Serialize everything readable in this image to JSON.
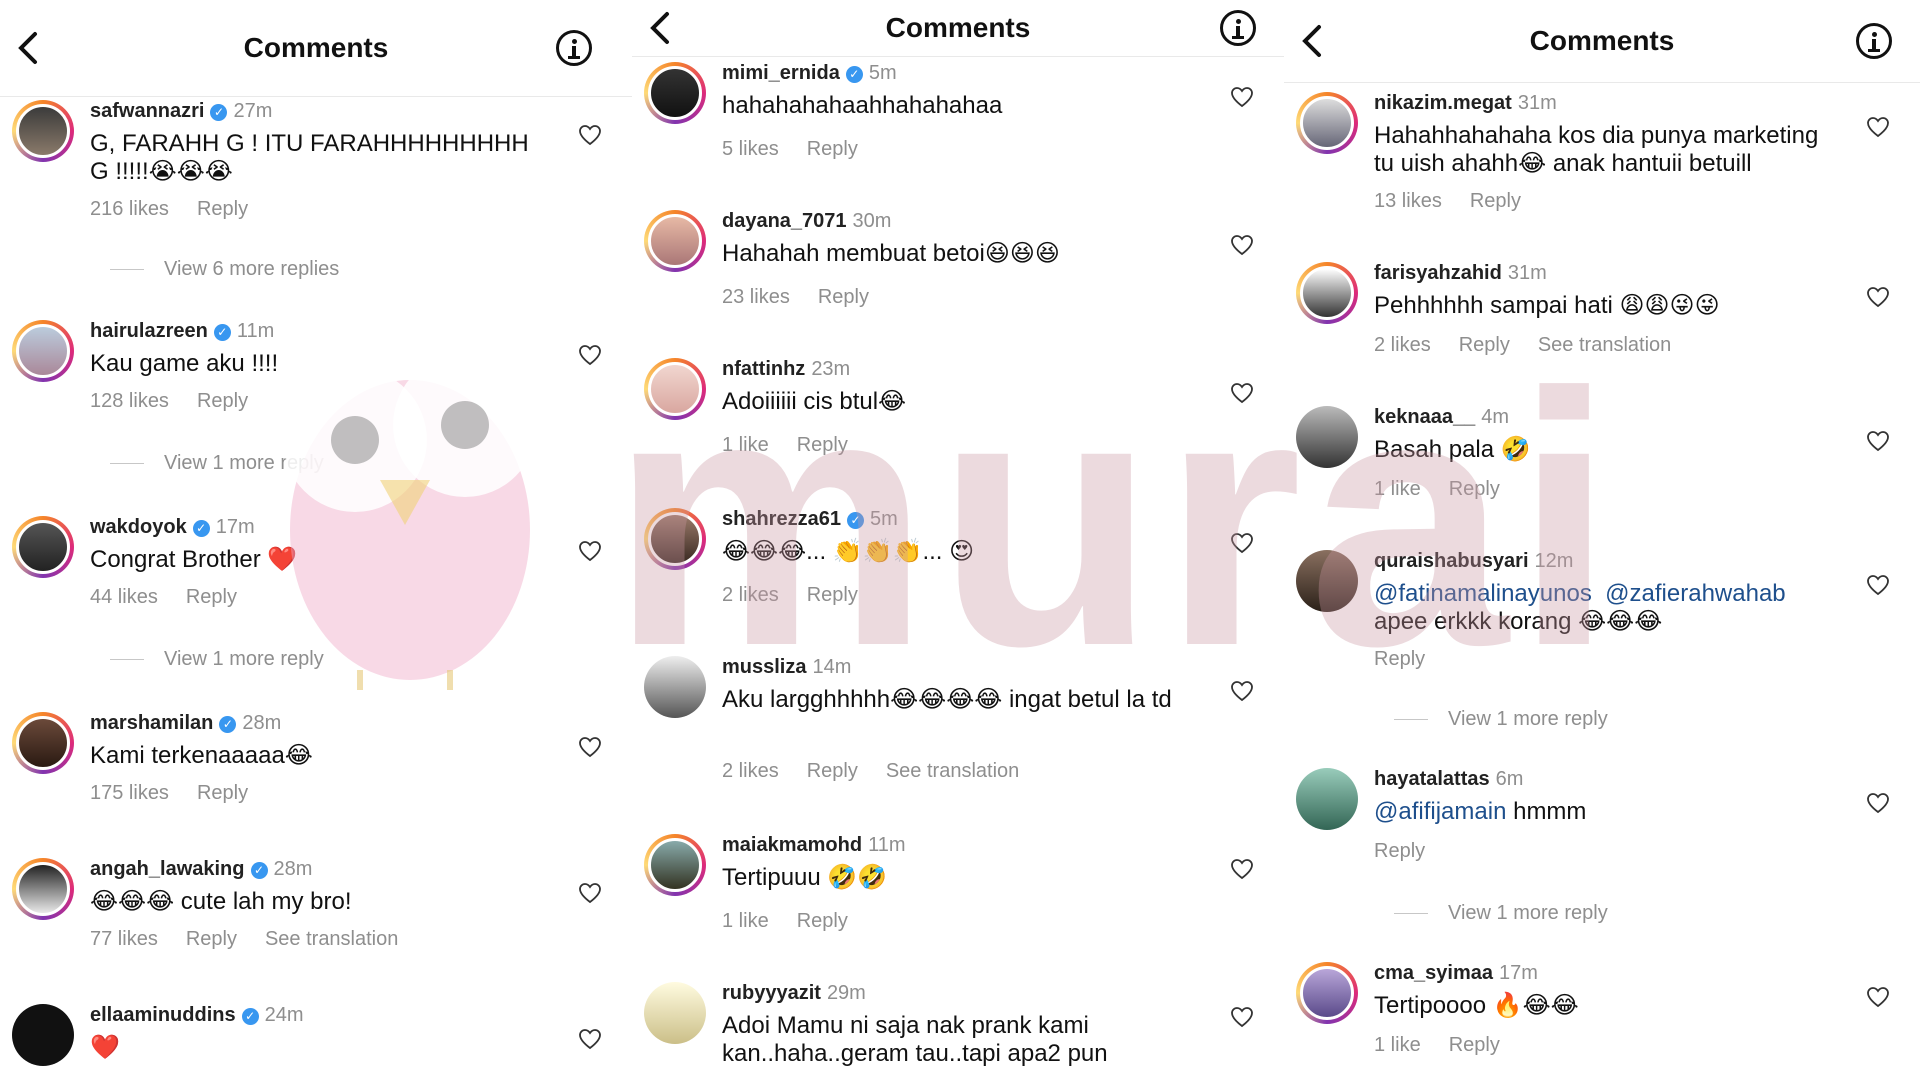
{
  "title": "Comments",
  "panel1": {
    "comments": [
      {
        "user": "safwannazri",
        "verified": true,
        "time": "27m",
        "text": "G, FARAHH G ! ITU FARAHHHHHHHHH G !!!!!😭😭😭",
        "likes": "216 likes",
        "reply": "Reply",
        "more": "View 6 more replies"
      },
      {
        "user": "hairulazreen",
        "verified": true,
        "time": "11m",
        "text": "Kau game aku !!!!",
        "likes": "128 likes",
        "reply": "Reply",
        "more": "View 1 more reply"
      },
      {
        "user": "wakdoyok",
        "verified": true,
        "time": "17m",
        "text": "Congrat Brother ❤️",
        "likes": "44 likes",
        "reply": "Reply",
        "more": "View 1 more reply"
      },
      {
        "user": "marshamilan",
        "verified": true,
        "time": "28m",
        "text": "Kami terkenaaaaa😂",
        "likes": "175 likes",
        "reply": "Reply"
      },
      {
        "user": "angah_lawaking",
        "verified": true,
        "time": "28m",
        "text": "😂😂😂 cute lah my bro!",
        "likes": "77 likes",
        "reply": "Reply",
        "translate": "See translation"
      },
      {
        "user": "ellaaminuddins",
        "verified": true,
        "time": "24m",
        "text": "❤️"
      }
    ]
  },
  "panel2": {
    "comments": [
      {
        "user": "mimi_ernida",
        "verified": true,
        "time": "5m",
        "text": "hahahahahaahhahahahaa",
        "likes": "5 likes",
        "reply": "Reply"
      },
      {
        "user": "dayana_7071",
        "verified": false,
        "time": "30m",
        "text": "Hahahah membuat betoi😆😆😆",
        "likes": "23 likes",
        "reply": "Reply"
      },
      {
        "user": "nfattinhz",
        "verified": false,
        "time": "23m",
        "text": "Adoiiiiii cis btul😂",
        "likes": "1 like",
        "reply": "Reply"
      },
      {
        "user": "shahrezza61",
        "verified": true,
        "time": "5m",
        "text": "😂😂😂... 👏👏👏... 😍",
        "likes": "2 likes",
        "reply": "Reply"
      },
      {
        "user": "mussliza",
        "verified": false,
        "time": "14m",
        "text": "Aku largghhhhh😂😂😂😂 ingat betul la td",
        "likes": "2 likes",
        "reply": "Reply",
        "translate": "See translation"
      },
      {
        "user": "maiakmamohd",
        "verified": false,
        "time": "11m",
        "text": "Tertipuuu 🤣🤣",
        "likes": "1 like",
        "reply": "Reply"
      },
      {
        "user": "rubyyyazit",
        "verified": false,
        "time": "29m",
        "text": "Adoi Mamu ni saja nak prank kami kan..haha..geram tau..tapi apa2 pun"
      }
    ]
  },
  "panel3": {
    "comments": [
      {
        "user": "nikazim.megat",
        "verified": false,
        "time": "31m",
        "text": "Hahahhahahaha kos dia punya marketing tu uish ahahh😂 anak hantuii betuill",
        "likes": "13 likes",
        "reply": "Reply"
      },
      {
        "user": "farisyahzahid",
        "verified": false,
        "time": "31m",
        "text": "Pehhhhhh sampai hati 😩😩😜😜",
        "likes": "2 likes",
        "reply": "Reply",
        "translate": "See translation"
      },
      {
        "user": "keknaaa__",
        "verified": false,
        "time": "4m",
        "text": "Basah pala 🤣",
        "likes": "1 like",
        "reply": "Reply"
      },
      {
        "user": "quraishabusyari",
        "verified": false,
        "time": "12m",
        "mention1": "@fatinamalinayunos",
        "mention2": "@zafierahwahab",
        "text": "apee erkkk korang 😂😂😂",
        "reply": "Reply",
        "more": "View 1 more reply"
      },
      {
        "user": "hayatalattas",
        "verified": false,
        "time": "6m",
        "mention1": "@afifijamain",
        "text": " hmmm",
        "reply": "Reply",
        "more": "View 1 more reply"
      },
      {
        "user": "cma_syimaa",
        "verified": false,
        "time": "17m",
        "text": "Tertipoooo 🔥😂😂",
        "likes": "1 like",
        "reply": "Reply"
      }
    ]
  },
  "watermark": "murai",
  "colors": {
    "verified": "#3897f0",
    "muted": "#8e8e8e",
    "mention": "#1e4f8c"
  }
}
